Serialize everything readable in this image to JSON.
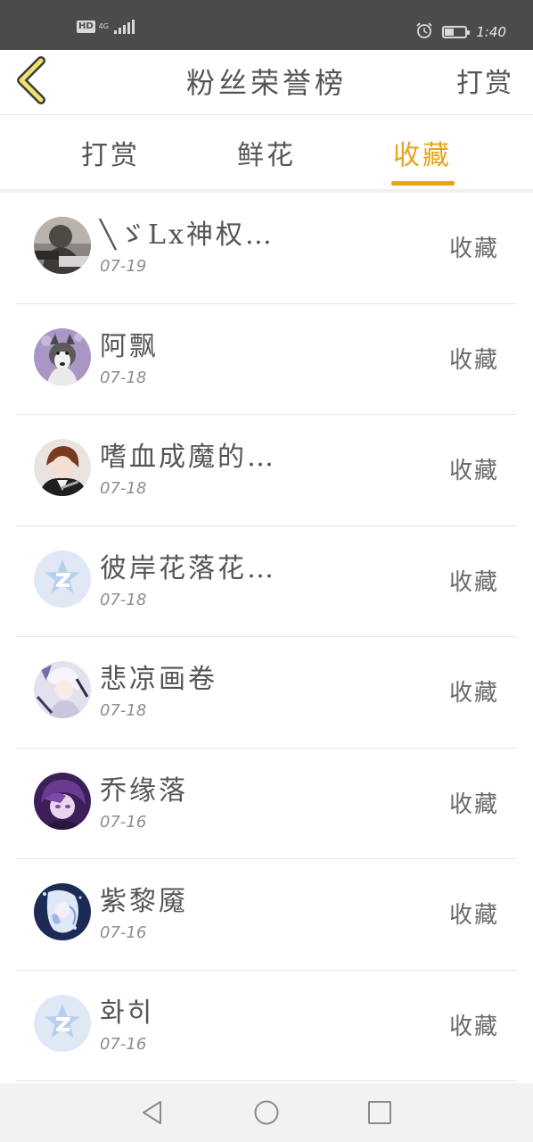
{
  "status_bar": {
    "hd": "HD",
    "network": "4G",
    "time": "1:40",
    "battery_level": 0.45
  },
  "header": {
    "title": "粉丝荣誉榜",
    "reward_link": "打赏"
  },
  "tabs": [
    {
      "label": "打赏",
      "active": false
    },
    {
      "label": "鲜花",
      "active": false
    },
    {
      "label": "收藏",
      "active": true
    }
  ],
  "colors": {
    "accent": "#e8a418",
    "status_bar": "#4b4b4b",
    "text": "#555555",
    "date": "#8d8d8d"
  },
  "fans": [
    {
      "nickname": "╲ゞLx神权…",
      "date": "07-19",
      "action": "收藏",
      "avatar": "photo-person"
    },
    {
      "nickname": "阿飘",
      "date": "07-18",
      "action": "收藏",
      "avatar": "photo-husky"
    },
    {
      "nickname": "嗜血成魔的…",
      "date": "07-18",
      "action": "收藏",
      "avatar": "anime-boy"
    },
    {
      "nickname": "彼岸花落花…",
      "date": "07-18",
      "action": "收藏",
      "avatar": "default-qq"
    },
    {
      "nickname": "悲凉画卷",
      "date": "07-18",
      "action": "收藏",
      "avatar": "anime-white"
    },
    {
      "nickname": "乔缘落",
      "date": "07-16",
      "action": "收藏",
      "avatar": "anime-purple"
    },
    {
      "nickname": "紫黎魇",
      "date": "07-16",
      "action": "收藏",
      "avatar": "anime-blue"
    },
    {
      "nickname": "화히",
      "date": "07-16",
      "action": "收藏",
      "avatar": "default-qq"
    }
  ],
  "nav_bar": {
    "buttons": [
      "back-triangle-icon",
      "home-circle-icon",
      "recent-square-icon"
    ]
  }
}
